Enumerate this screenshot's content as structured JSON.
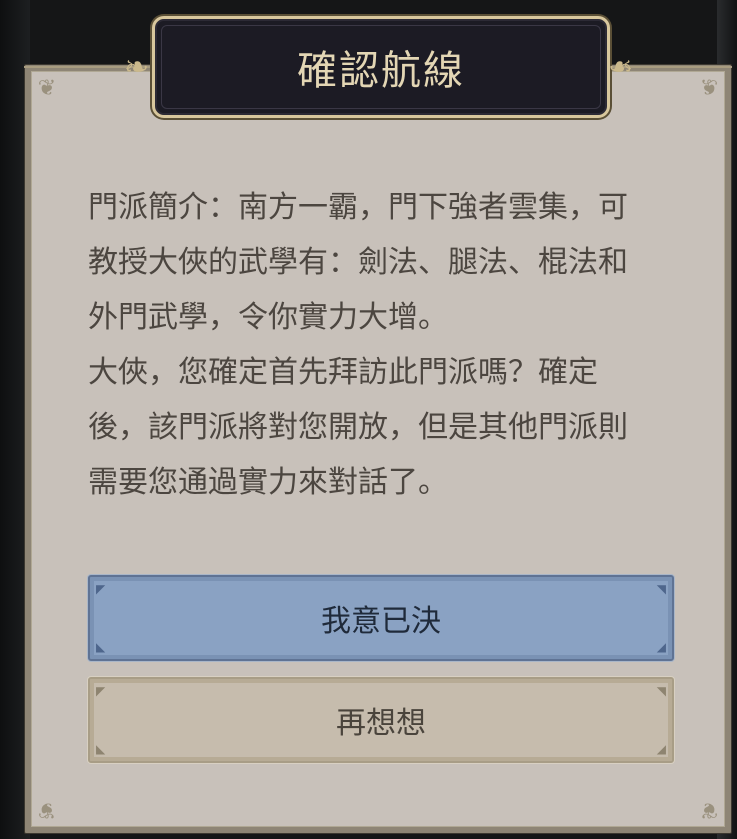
{
  "dialog": {
    "title": "確認航線",
    "body_lines": [
      "門派簡介：南方一霸，門下強者雲集，可",
      "教授大俠的武學有：劍法、腿法、棍法和",
      "外門武學，令你實力大增。",
      "大俠，您確定首先拜訪此門派嗎？確定",
      "後，該門派將對您開放，但是其他門派則",
      "需要您通過實力來對話了。"
    ],
    "confirm_label": "我意已決",
    "cancel_label": "再想想"
  },
  "icons": {
    "corner_ornament": "corner-flourish-icon",
    "title_flourish": "scroll-flourish-icon"
  },
  "colors": {
    "panel_bg": "#c8c1ba",
    "title_bg": "#1c1b24",
    "title_border": "#d8c79d",
    "confirm_bg": "#8aa2c3",
    "cancel_bg": "#c6bcad",
    "body_text": "#4c4640"
  }
}
